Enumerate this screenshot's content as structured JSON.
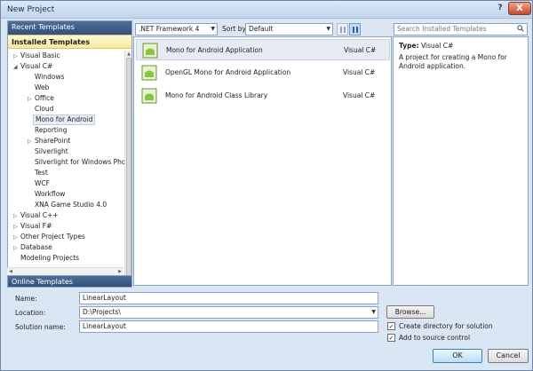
{
  "window": {
    "title": "New Project",
    "help_label": "?",
    "close_label": "X"
  },
  "sidebar": {
    "recent_label": "Recent Templates",
    "installed_label": "Installed Templates",
    "online_label": "Online Templates",
    "tree": [
      {
        "label": "Visual Basic",
        "arrow": "▷"
      },
      {
        "label": "Visual C#",
        "arrow": "◢"
      },
      {
        "label": "Windows",
        "arrow": ""
      },
      {
        "label": "Web",
        "arrow": ""
      },
      {
        "label": "Office",
        "arrow": "▷"
      },
      {
        "label": "Cloud",
        "arrow": ""
      },
      {
        "label": "Mono for Android",
        "arrow": ""
      },
      {
        "label": "Reporting",
        "arrow": ""
      },
      {
        "label": "SharePoint",
        "arrow": "▷"
      },
      {
        "label": "Silverlight",
        "arrow": ""
      },
      {
        "label": "Silverlight for Windows Phone",
        "arrow": ""
      },
      {
        "label": "Test",
        "arrow": ""
      },
      {
        "label": "WCF",
        "arrow": ""
      },
      {
        "label": "Workflow",
        "arrow": ""
      },
      {
        "label": "XNA Game Studio 4.0",
        "arrow": ""
      },
      {
        "label": "Visual C++",
        "arrow": "▷"
      },
      {
        "label": "Visual F#",
        "arrow": "▷"
      },
      {
        "label": "Other Project Types",
        "arrow": "▷"
      },
      {
        "label": "Database",
        "arrow": "▷"
      },
      {
        "label": "Modeling Projects",
        "arrow": ""
      }
    ]
  },
  "toolbar": {
    "framework": ".NET Framework 4",
    "sort_label": "Sort by:",
    "sort_value": "Default",
    "search_placeholder": "Search Installed Templates"
  },
  "templates": [
    {
      "name": "Mono for Android Application",
      "lang": "Visual C#"
    },
    {
      "name": "OpenGL Mono for Android Application",
      "lang": "Visual C#"
    },
    {
      "name": "Mono for Android Class Library",
      "lang": "Visual C#"
    }
  ],
  "details": {
    "type_label": "Type:",
    "type_value": "Visual C#",
    "description": "A project for creating a Mono for Android application."
  },
  "form": {
    "name_label": "Name:",
    "name_value": "LinearLayout",
    "location_label": "Location:",
    "location_value": "D:\\Projects\\",
    "solution_label": "Solution name:",
    "solution_value": "LinearLayout",
    "browse_label": "Browse...",
    "create_dir_label": "Create directory for solution",
    "source_control_label": "Add to source control"
  },
  "buttons": {
    "ok_label": "OK",
    "cancel_label": "Cancel"
  },
  "colors": {
    "accent": "#33507e",
    "android_green": "#8ac43f"
  }
}
